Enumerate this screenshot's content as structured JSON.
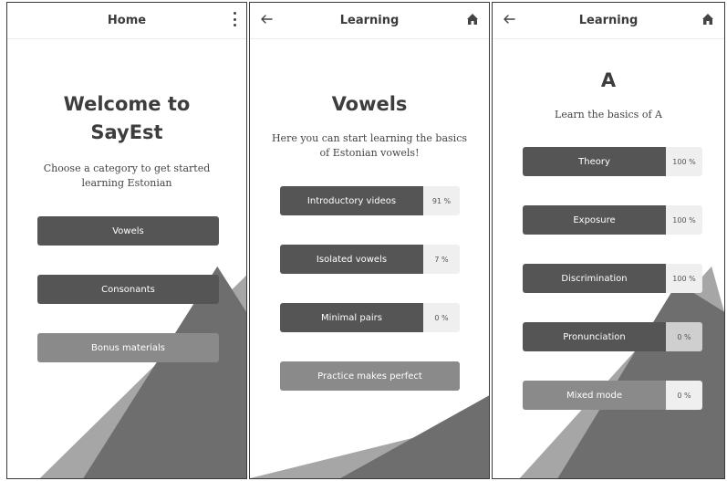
{
  "screen_home": {
    "title": "Home",
    "heading_line1": "Welcome to",
    "heading_line2": "SayEst",
    "subtitle_line1": "Choose a category to get started",
    "subtitle_line2": "learning Estonian",
    "buttons": [
      {
        "label": "Vowels"
      },
      {
        "label": "Consonants"
      },
      {
        "label": "Bonus materials"
      }
    ]
  },
  "screen_vowels": {
    "title": "Learning",
    "heading": "Vowels",
    "subtitle_line1": "Here you can start learning the basics",
    "subtitle_line2": "of Estonian vowels!",
    "items": [
      {
        "label": "Introductory videos",
        "percent": "91 %",
        "progress": 0.91
      },
      {
        "label": "Isolated vowels",
        "percent": "7 %",
        "progress": 0.07
      },
      {
        "label": "Minimal pairs",
        "percent": "0 %",
        "progress": 0
      }
    ],
    "practice_label": "Practice makes perfect"
  },
  "screen_a": {
    "title": "Learning",
    "heading": "A",
    "subtitle": "Learn the basics of A",
    "items": [
      {
        "label": "Theory",
        "percent": "100 %",
        "progress": 1.0
      },
      {
        "label": "Exposure",
        "percent": "100 %",
        "progress": 1.0
      },
      {
        "label": "Discrimination",
        "percent": "100 %",
        "progress": 1.0
      },
      {
        "label": "Pronunciation",
        "percent": "0 %",
        "progress": 0
      },
      {
        "label": "Mixed mode",
        "percent": "0 %",
        "progress": 0
      }
    ]
  },
  "colors": {
    "button_dark": "#555555",
    "button_light": "#8a8a8a",
    "percent_bg": "#efefef",
    "heading": "#3d3d3d"
  },
  "icons": {
    "menu": "more-vertical-icon",
    "back": "arrow-left-icon",
    "home": "home-icon"
  }
}
